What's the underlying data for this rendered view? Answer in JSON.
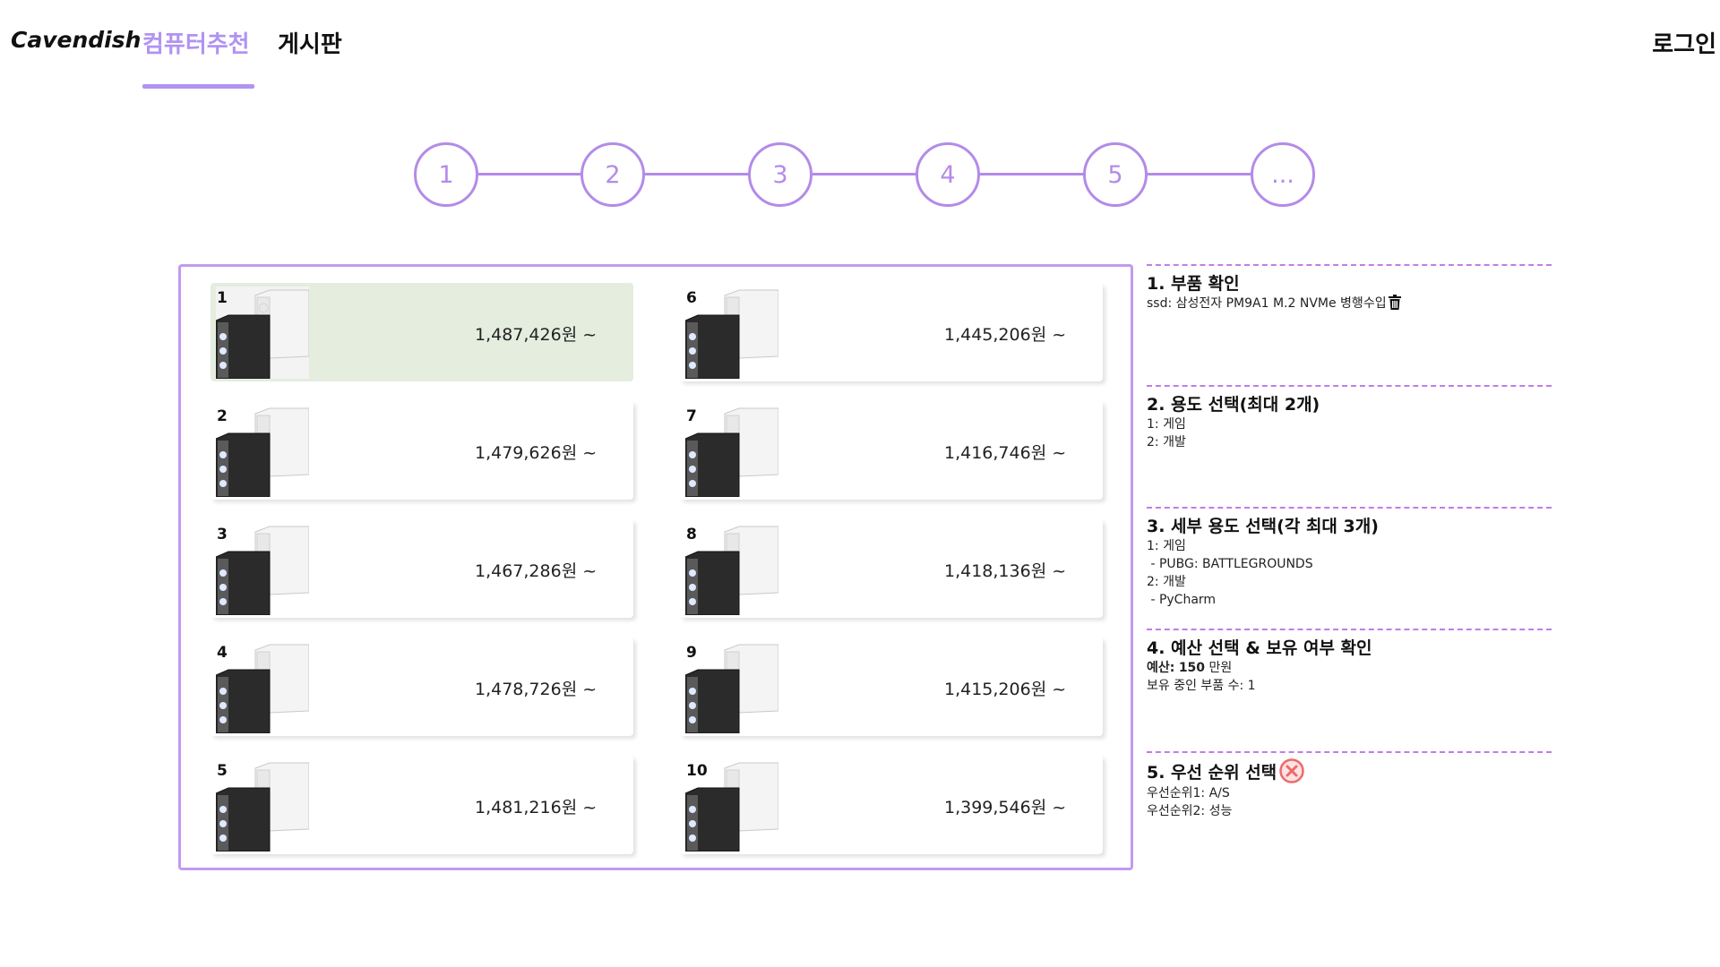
{
  "header": {
    "brand": "Cavendish",
    "tabs": [
      {
        "label": "컴퓨터추천",
        "active": true
      },
      {
        "label": "게시판",
        "active": false
      }
    ],
    "login": "로그인",
    "accent_color": "#b193f2"
  },
  "stepper": {
    "steps": [
      "1",
      "2",
      "3",
      "4",
      "5",
      "..."
    ],
    "color": "#b48be8"
  },
  "results": [
    {
      "rank": "1",
      "price": "1,487,426원 ~",
      "selected": true
    },
    {
      "rank": "2",
      "price": "1,479,626원 ~",
      "selected": false
    },
    {
      "rank": "3",
      "price": "1,467,286원 ~",
      "selected": false
    },
    {
      "rank": "4",
      "price": "1,478,726원 ~",
      "selected": false
    },
    {
      "rank": "5",
      "price": "1,481,216원 ~",
      "selected": false
    },
    {
      "rank": "6",
      "price": "1,445,206원 ~",
      "selected": false
    },
    {
      "rank": "7",
      "price": "1,416,746원 ~",
      "selected": false
    },
    {
      "rank": "8",
      "price": "1,418,136원 ~",
      "selected": false
    },
    {
      "rank": "9",
      "price": "1,415,206원 ~",
      "selected": false
    },
    {
      "rank": "10",
      "price": "1,399,546원 ~",
      "selected": false
    }
  ],
  "summary": {
    "parts": {
      "title": "1. 부품 확인",
      "item": "ssd: 삼성전자 PM9A1 M.2 NVMe 병행수입"
    },
    "usage": {
      "title": "2. 용도 선택(최대 2개)",
      "lines": [
        "1: 게임",
        "2: 개발"
      ]
    },
    "detail": {
      "title": "3. 세부 용도 선택(각 최대 3개)",
      "lines": [
        "1: 게임",
        " - PUBG: BATTLEGROUNDS",
        "2: 개발",
        " - PyCharm"
      ]
    },
    "budget": {
      "title": "4. 예산 선택 & 보유 여부 확인",
      "budget_label": "예산:",
      "budget_value": "150",
      "budget_unit": "만원",
      "owned": "보유 중인 부품 수: 1"
    },
    "priority": {
      "title": "5. 우선 순위 선택",
      "lines": [
        "우선순위1: A/S",
        "우선순위2: 성능"
      ]
    }
  }
}
